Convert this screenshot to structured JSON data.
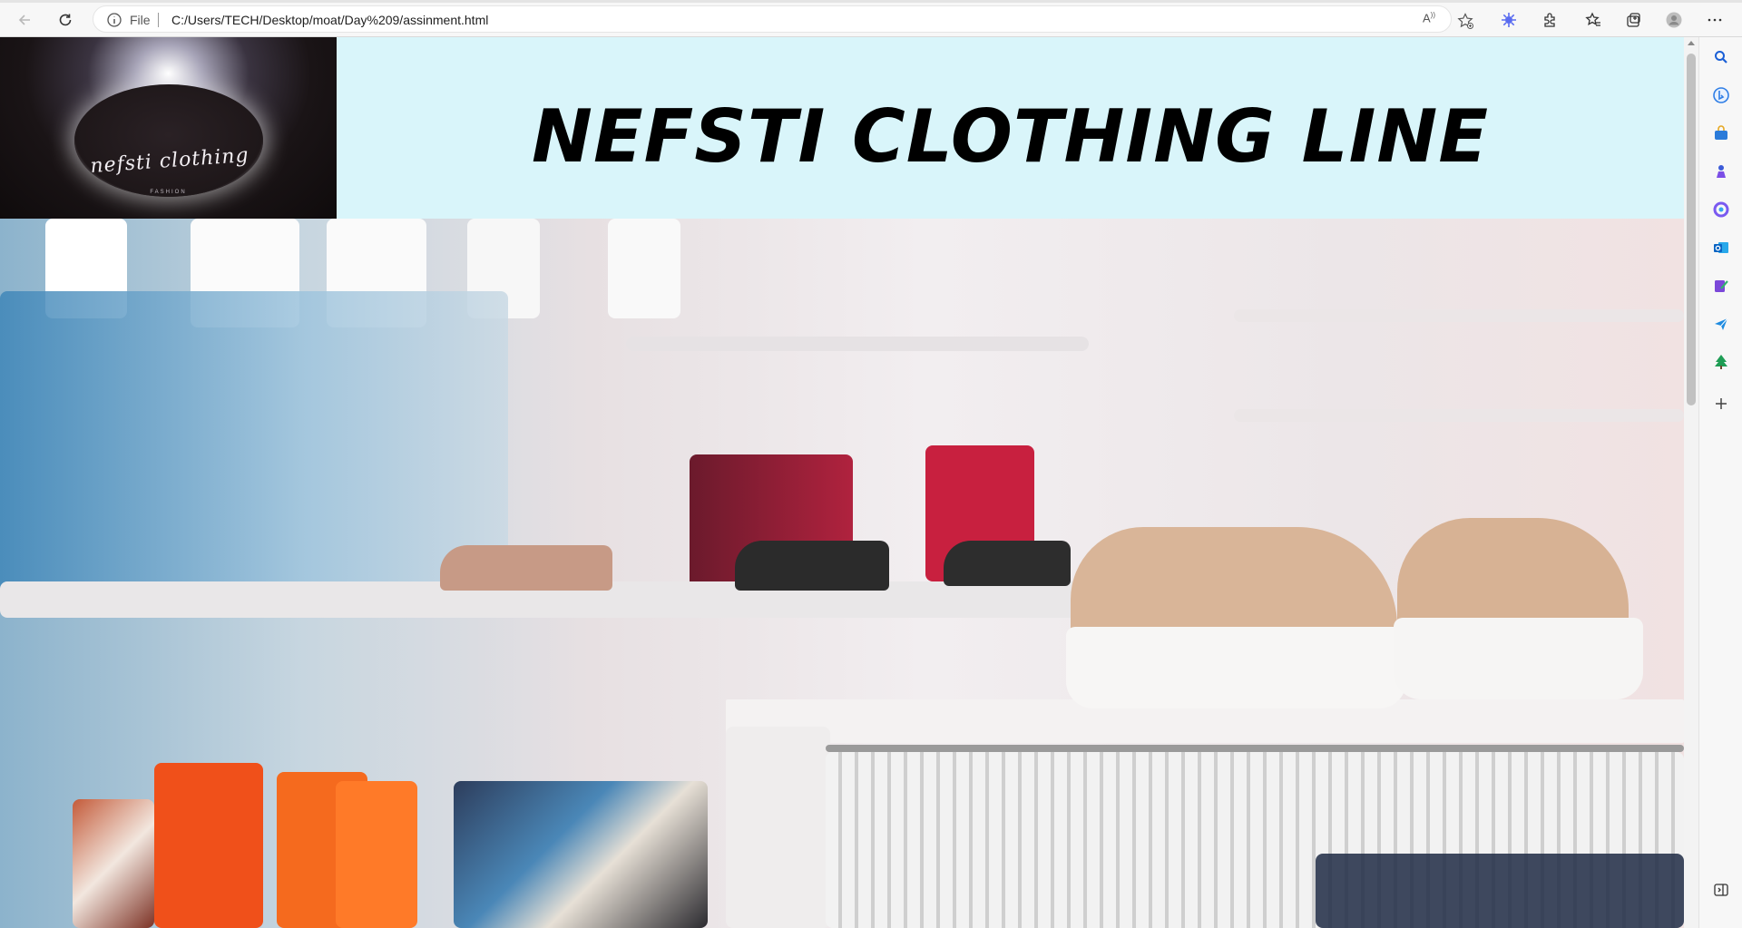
{
  "browser": {
    "address": {
      "scheme_label": "File",
      "url": "C:/Users/TECH/Desktop/moat/Day%209/assinment.html"
    },
    "toolbar_icons": [
      "back-icon",
      "refresh-icon",
      "site-info-icon",
      "read-aloud-icon",
      "add-favorite-icon",
      "copilot-icon",
      "extensions-icon",
      "favorites-icon",
      "collections-icon",
      "profile-icon",
      "more-icon"
    ],
    "sidebar_icons": [
      "search-icon",
      "bing-icon",
      "shopping-icon",
      "games-icon",
      "microsoft365-icon",
      "outlook-icon",
      "drop-icon",
      "send-icon",
      "tree-icon",
      "add-icon",
      "sidebar-toggle-icon"
    ]
  },
  "page": {
    "title": "NEFSTI CLOTHING LINE",
    "logo": {
      "script_text": "nefsti clothing",
      "tagline": "FASHION"
    },
    "header_bg": "#d9f5fa"
  }
}
